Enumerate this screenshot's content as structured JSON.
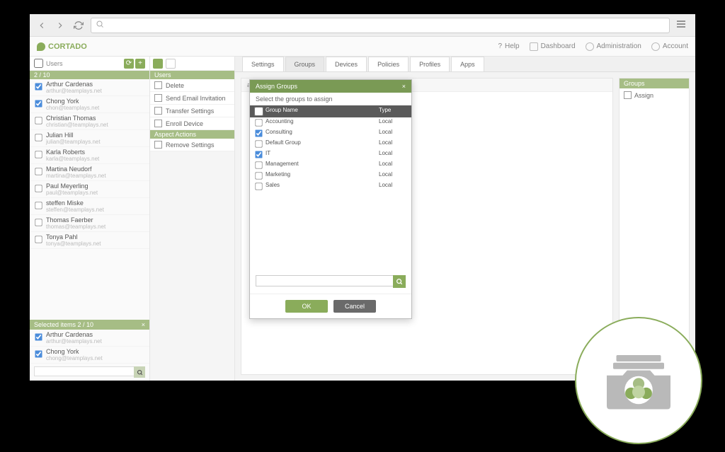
{
  "brand": "CORTADO",
  "header": {
    "help": "Help",
    "dashboard": "Dashboard",
    "administration": "Administration",
    "account": "Account"
  },
  "sidebar": {
    "title": "Users",
    "count": "2 / 10",
    "users": [
      {
        "name": "Arthur Cardenas",
        "email": "arthur@teamplays.net",
        "checked": true
      },
      {
        "name": "Chong York",
        "email": "chon@teamplays.net",
        "checked": true
      },
      {
        "name": "Christian Thomas",
        "email": "christian@teamplays.net",
        "checked": false
      },
      {
        "name": "Julian Hill",
        "email": "julian@teamplays.net",
        "checked": false
      },
      {
        "name": "Karla Roberts",
        "email": "karla@teamplays.net",
        "checked": false
      },
      {
        "name": "Martina Neudorf",
        "email": "martina@teamplays.net",
        "checked": false
      },
      {
        "name": "Paul Meyerling",
        "email": "paul@teamplays.net",
        "checked": false
      },
      {
        "name": "steffen Miske",
        "email": "steffen@teamplays.net",
        "checked": false
      },
      {
        "name": "Thomas Faerber",
        "email": "thomas@teamplays.net",
        "checked": false
      },
      {
        "name": "Tonya Pahl",
        "email": "tonya@teamplays.net",
        "checked": false
      }
    ],
    "selected_title": "Selected items 2 / 10",
    "selected": [
      {
        "name": "Arthur Cardenas",
        "email": "arthur@teamplays.net"
      },
      {
        "name": "Chong York",
        "email": "chong@teamplays.net"
      }
    ]
  },
  "actions": {
    "section1": "Users",
    "items1": [
      {
        "label": "Delete"
      },
      {
        "label": "Send Email Invitation"
      },
      {
        "label": "Transfer Settings"
      },
      {
        "label": "Enroll Device"
      }
    ],
    "section2": "Aspect Actions",
    "items2": [
      {
        "label": "Remove Settings"
      }
    ]
  },
  "tabs": [
    "Settings",
    "Groups",
    "Devices",
    "Policies",
    "Profiles",
    "Apps"
  ],
  "detail": {
    "email": "arthur@teamplays.net"
  },
  "groups_panel": {
    "title": "Groups",
    "assign": "Assign"
  },
  "modal": {
    "title": "Assign Groups",
    "subtitle": "Select the groups to assign",
    "col2": "Group Name",
    "col3": "Type",
    "rows": [
      {
        "name": "Accounting",
        "type": "Local",
        "checked": false
      },
      {
        "name": "Consulting",
        "type": "Local",
        "checked": true
      },
      {
        "name": "Default Group",
        "type": "Local",
        "checked": false
      },
      {
        "name": "IT",
        "type": "Local",
        "checked": true
      },
      {
        "name": "Management",
        "type": "Local",
        "checked": false
      },
      {
        "name": "Marketing",
        "type": "Local",
        "checked": false
      },
      {
        "name": "Sales",
        "type": "Local",
        "checked": false
      }
    ],
    "ok": "OK",
    "cancel": "Cancel"
  }
}
